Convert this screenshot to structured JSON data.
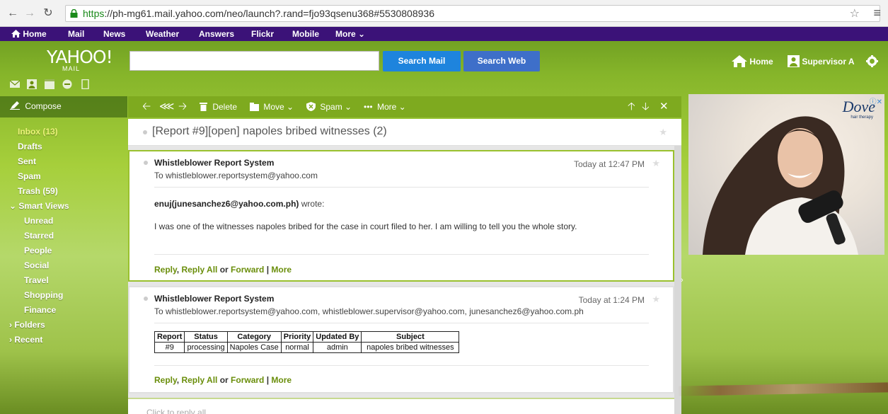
{
  "browser": {
    "url_https": "https",
    "url_rest": "://ph-mg61.mail.yahoo.com/neo/launch?.rand=fjo93qsenu368#5530808936"
  },
  "topbar": {
    "items": [
      "Home",
      "Mail",
      "News",
      "Weather",
      "Answers",
      "Flickr",
      "Mobile",
      "More ⌄"
    ]
  },
  "header": {
    "logo": "YAHOO!",
    "logo_sub": "MAIL",
    "search_mail_label": "Search Mail",
    "search_web_label": "Search Web",
    "home_label": "Home",
    "user_label": "Supervisor A",
    "colors": {
      "brand_purple": "#3b1278",
      "search_blue": "#1e84dd",
      "link_green": "#6a8e0b"
    }
  },
  "sidebar": {
    "compose_label": "Compose",
    "folders": [
      {
        "label": "Inbox (13)"
      },
      {
        "label": "Drafts"
      },
      {
        "label": "Sent"
      },
      {
        "label": "Spam"
      },
      {
        "label": "Trash (59)"
      },
      {
        "label": "Smart Views"
      },
      {
        "label": "Unread"
      },
      {
        "label": "Starred"
      },
      {
        "label": "People"
      },
      {
        "label": "Social"
      },
      {
        "label": "Travel"
      },
      {
        "label": "Shopping"
      },
      {
        "label": "Finance"
      },
      {
        "label": "Folders"
      },
      {
        "label": "Recent"
      }
    ]
  },
  "toolbar": {
    "delete_label": "Delete",
    "move_label": "Move",
    "spam_label": "Spam",
    "more_label": "More"
  },
  "thread": {
    "subject": "[Report #9][open] napoles bribed witnesses (2)",
    "messages": [
      {
        "sender": "Whistleblower Report System",
        "to": "To  whistleblower.reportsystem@yahoo.com",
        "time": "Today at 12:47 PM",
        "wrote_author": "enuj(junesanchez6@yahoo.com.ph)",
        "wrote_suffix": " wrote:",
        "body": "I was one of the witnesses napoles bribed for the case in court filed to her. I am willing to tell you the whole story."
      },
      {
        "sender": "Whistleblower Report System",
        "to": "To  whistleblower.reportsystem@yahoo.com, whistleblower.supervisor@yahoo.com, junesanchez6@yahoo.com.ph",
        "time": "Today at 1:24 PM",
        "table": {
          "headers": [
            "Report",
            "Status",
            "Category",
            "Priority",
            "Updated By",
            "Subject"
          ],
          "row": [
            "#9",
            "processing",
            "Napoles Case",
            "normal",
            "admin",
            "napoles bribed witnesses"
          ]
        }
      }
    ],
    "reply_links": {
      "reply": "Reply",
      "comma": ", ",
      "reply_all": "Reply All",
      "or": " or ",
      "forward": "Forward",
      "sep": " | ",
      "more": "More"
    },
    "click_to_reply": "Click to reply all"
  },
  "ad": {
    "brand": "Dove",
    "brand_sub": "hair therapy"
  }
}
